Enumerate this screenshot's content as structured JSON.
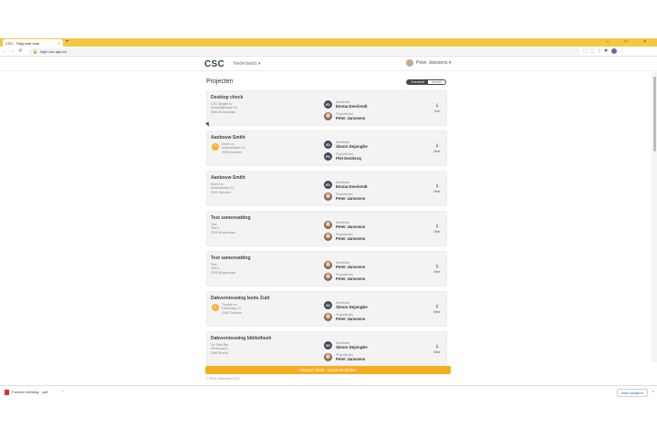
{
  "browser": {
    "tab_title": "CSC - Rapporte kaar",
    "tab_close": "×",
    "new_tab": "+",
    "window_controls": "– □ ×",
    "url": "login.csc-app.eu",
    "nav": {
      "back": "←",
      "forward": "→",
      "reload": "⟳"
    }
  },
  "header": {
    "logo": "CSC",
    "language": "Nederlands ▾",
    "user_name": "Peter Janssens ▾"
  },
  "page": {
    "title": "Projecten",
    "toggle_on": "Overzicht",
    "toggle_off": "Archief"
  },
  "projects": [
    {
      "title": "Desktop check",
      "address": [
        "CSC België nv",
        "Koninklijkelaan 10",
        "2500 Brasschaat"
      ],
      "badge": "",
      "p1": {
        "label": "Werfleider",
        "name": "Emma Devriendt",
        "initials": "ED",
        "photo": false
      },
      "p2": {
        "label": "Projectleider",
        "name": "Peter Janssens",
        "initials": "",
        "photo": true
      },
      "dir": "Toon"
    },
    {
      "title": "Aanbouw Smith",
      "address": [
        "Smith nv",
        "Industrielaan 12",
        "2900 Schoten"
      ],
      "badge": "!",
      "p1": {
        "label": "Werfleider",
        "name": "Simon Dejonghe",
        "initials": "SD",
        "photo": false
      },
      "p2": {
        "label": "Projectleider",
        "name": "Piet Declercq",
        "initials": "PD",
        "photo": false
      },
      "dir": "Meer"
    },
    {
      "title": "Aanbouw Smith",
      "address": [
        "Smith nv",
        "Industrielaan 12",
        "2900 Schoten"
      ],
      "badge": "",
      "p1": {
        "label": "Werfleider",
        "name": "Emma Devriendt",
        "initials": "ED",
        "photo": false
      },
      "p2": {
        "label": "Projectleider",
        "name": "Peter Janssens",
        "initials": "",
        "photo": true
      },
      "dir": "Meer"
    },
    {
      "title": "Test samenvatting",
      "address": [
        "Test",
        "Test 1",
        "2930 Brasschaat"
      ],
      "badge": "",
      "p1": {
        "label": "Werfleider",
        "name": "Peter Janssens",
        "initials": "",
        "photo": true
      },
      "p2": {
        "label": "Projectleider",
        "name": "Peter Janssens",
        "initials": "",
        "photo": true
      },
      "dir": "Meer"
    },
    {
      "title": "Test samenvatting",
      "address": [
        "Test",
        "Test 1",
        "2930 Brasschaat"
      ],
      "badge": "",
      "p1": {
        "label": "Werfleider",
        "name": "Peter Janssens",
        "initials": "",
        "photo": true
      },
      "p2": {
        "label": "Projectleider",
        "name": "Peter Janssens",
        "initials": "",
        "photo": true
      },
      "dir": "Meer"
    },
    {
      "title": "Dakvernieuwing Ieeds Zuid",
      "address": [
        "Trustee nv",
        "Haverweg 12",
        "2900 Schoten"
      ],
      "badge": "!",
      "p1": {
        "label": "Werfleider",
        "name": "Simon Dejonghe",
        "initials": "SD",
        "photo": false
      },
      "p2": {
        "label": "Projectleider",
        "name": "Peter Janssens",
        "initials": "",
        "photo": true
      },
      "dir": "Meer"
    },
    {
      "title": "Dakvernieuwing bibliotheek",
      "address": [
        "De Stad Ber",
        "Kerkhoeg 8",
        "2960 Brecht"
      ],
      "badge": "",
      "p1": {
        "label": "Werfleider",
        "name": "Simon Dejonghe",
        "initials": "SD",
        "photo": false
      },
      "p2": {
        "label": "Projectleider",
        "name": "Peter Janssens",
        "initials": "",
        "photo": true
      },
      "dir": "Meer"
    }
  ],
  "banner": "Nieuwe client - nieuw Bestellen",
  "copyright": "© Rise Informatie 2022",
  "downloads": {
    "file": "Facture inleiding....pdf",
    "more": "⌃",
    "show_all": "Alles bekijken",
    "close": "×"
  },
  "colors": {
    "tabstrip": "#f6c744",
    "accent": "#f5ad26",
    "avatar_dark": "#3f4a56"
  }
}
